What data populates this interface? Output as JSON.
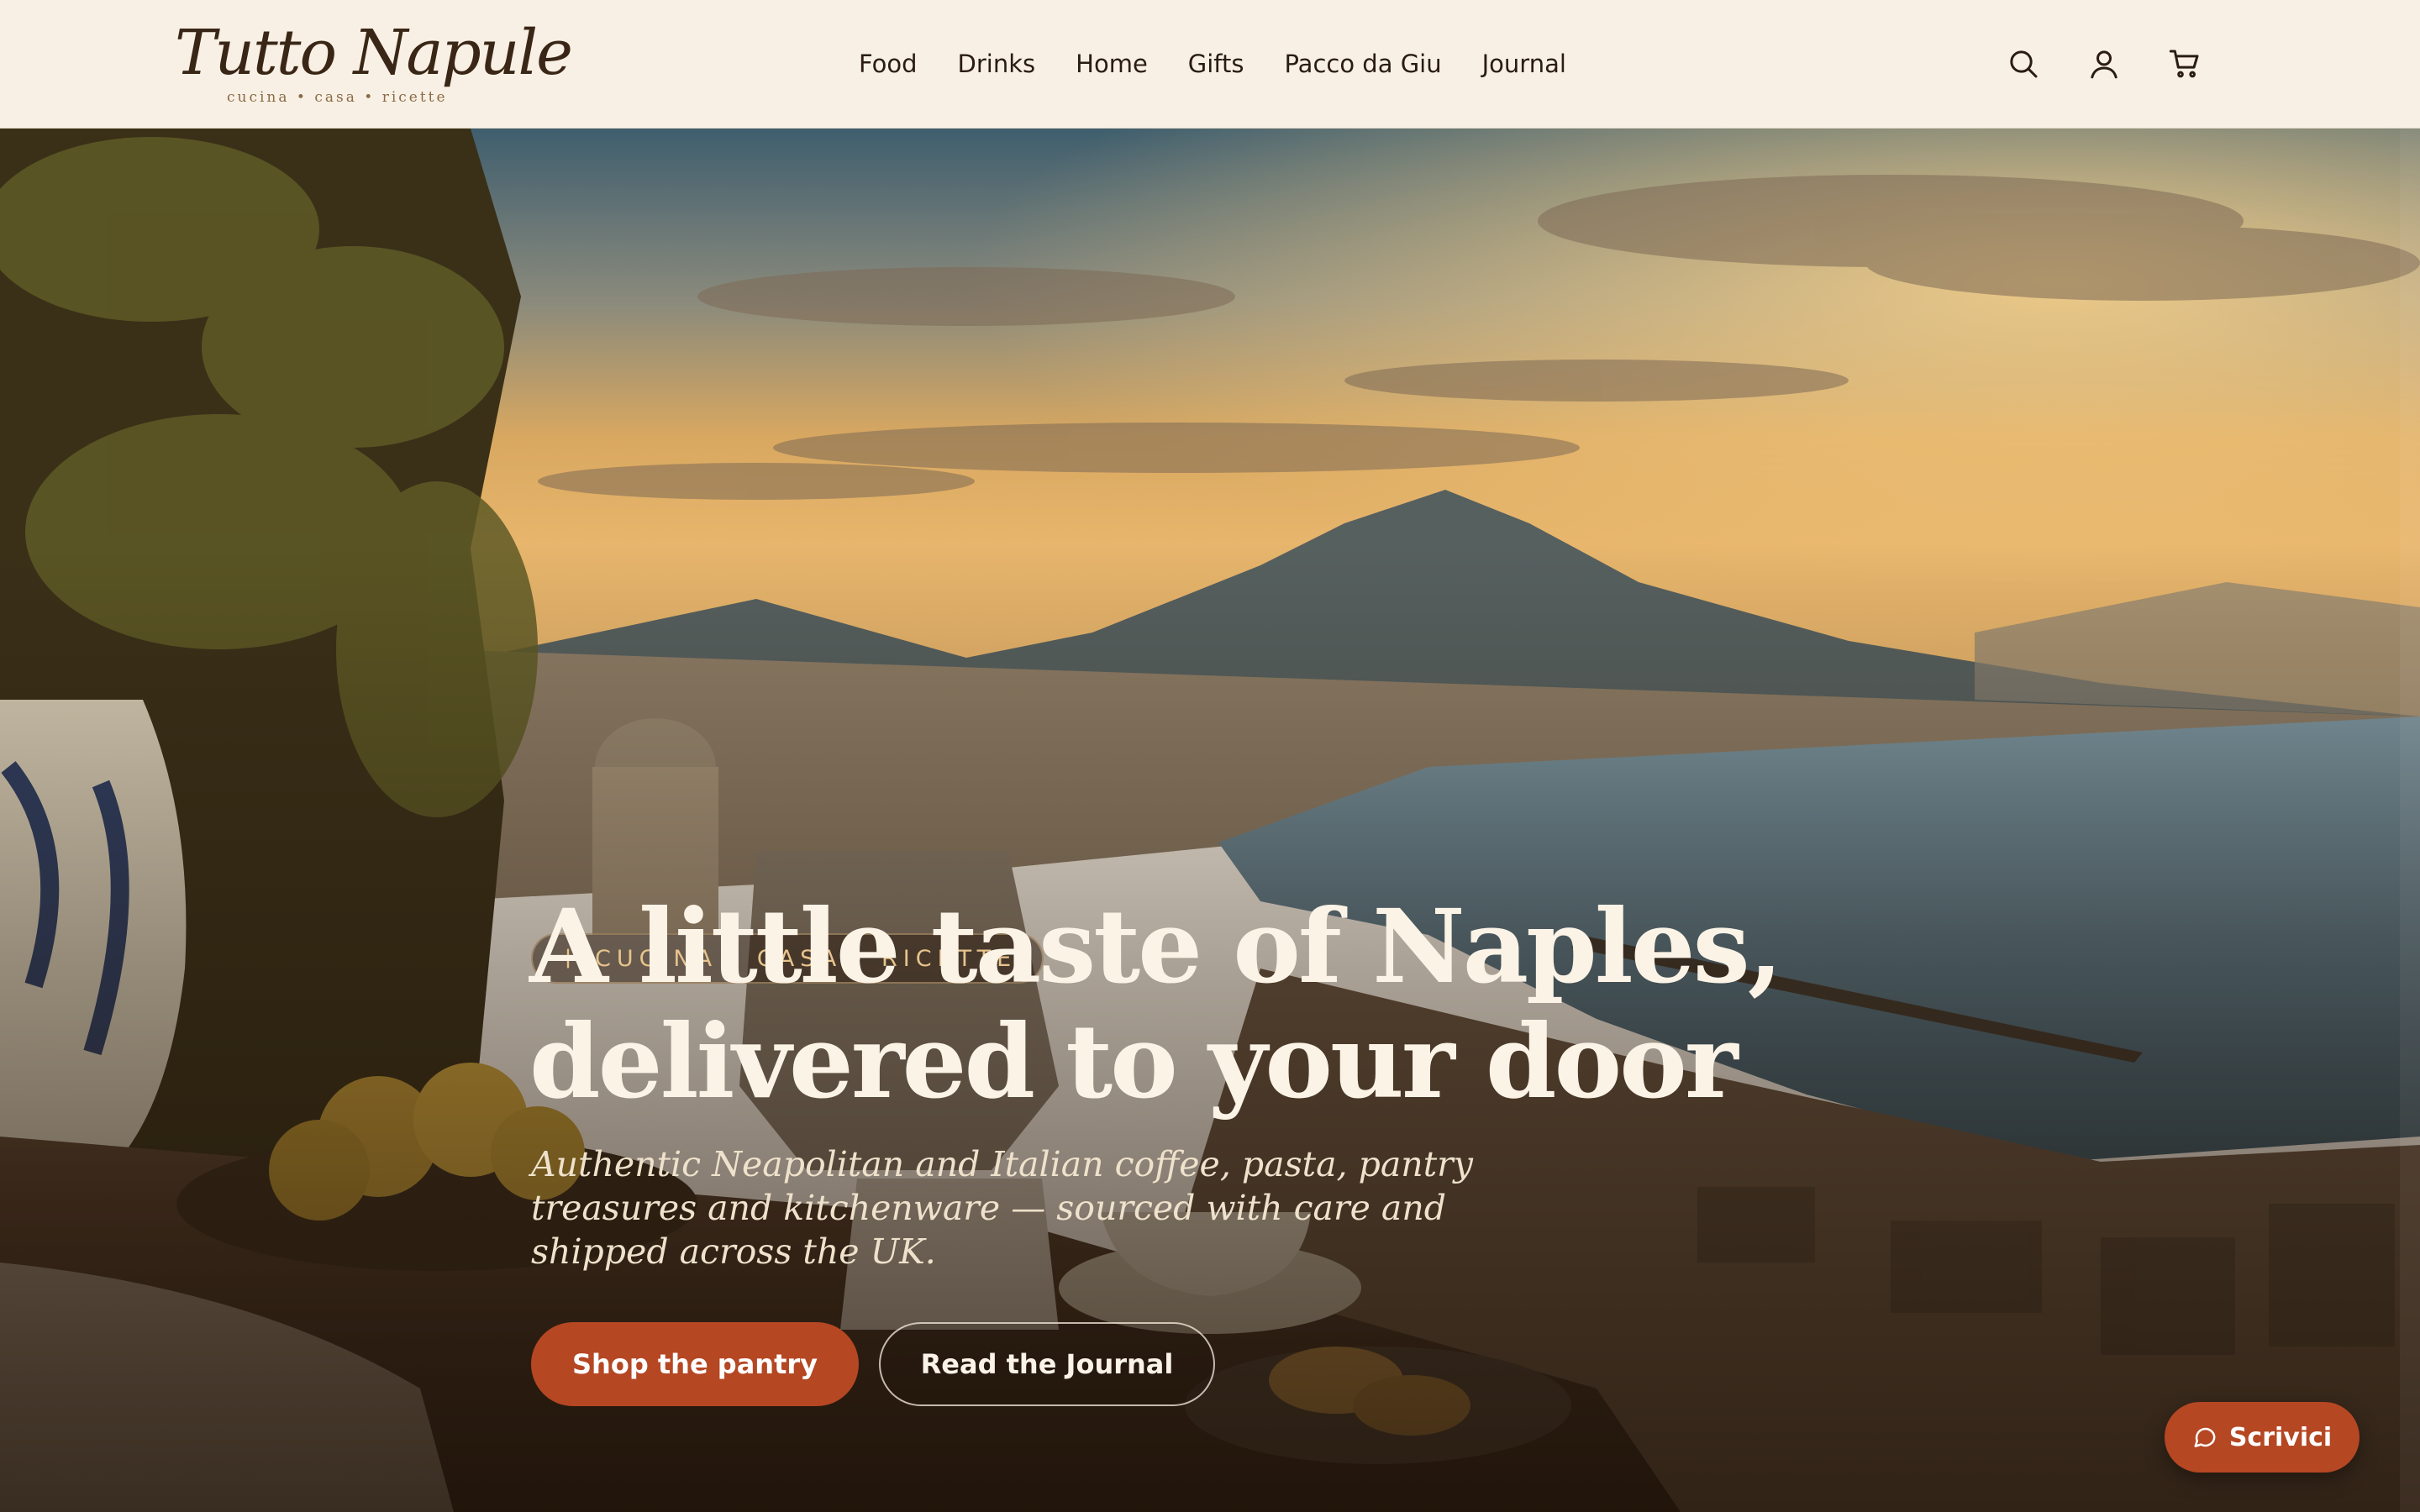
{
  "brand": {
    "name": "Tutto Napule",
    "tagline": "cucina • casa • ricette"
  },
  "nav": {
    "items": [
      {
        "label": "Food"
      },
      {
        "label": "Drinks"
      },
      {
        "label": "Home"
      },
      {
        "label": "Gifts"
      },
      {
        "label": "Pacco da Giu"
      },
      {
        "label": "Journal"
      }
    ]
  },
  "header_icons": [
    "search-icon",
    "account-icon",
    "cart-icon"
  ],
  "hero": {
    "eyebrow": "CUCINA · CASA · RICETTE",
    "headline_line1": "A little taste of Naples,",
    "headline_line2": "delivered to your door",
    "subtitle": "Authentic Neapolitan and Italian coffee, pasta, pantry treasures and kitchenware — sourced with care and shipped across the UK.",
    "primary_cta": "Shop the pantry",
    "secondary_cta": "Read the Journal"
  },
  "chat": {
    "label": "Scrivici"
  },
  "colors": {
    "accent": "#b54723",
    "header_bg": "#f8f0e4",
    "text_dark": "#2a1c10",
    "eyebrow": "#e8c48c"
  }
}
